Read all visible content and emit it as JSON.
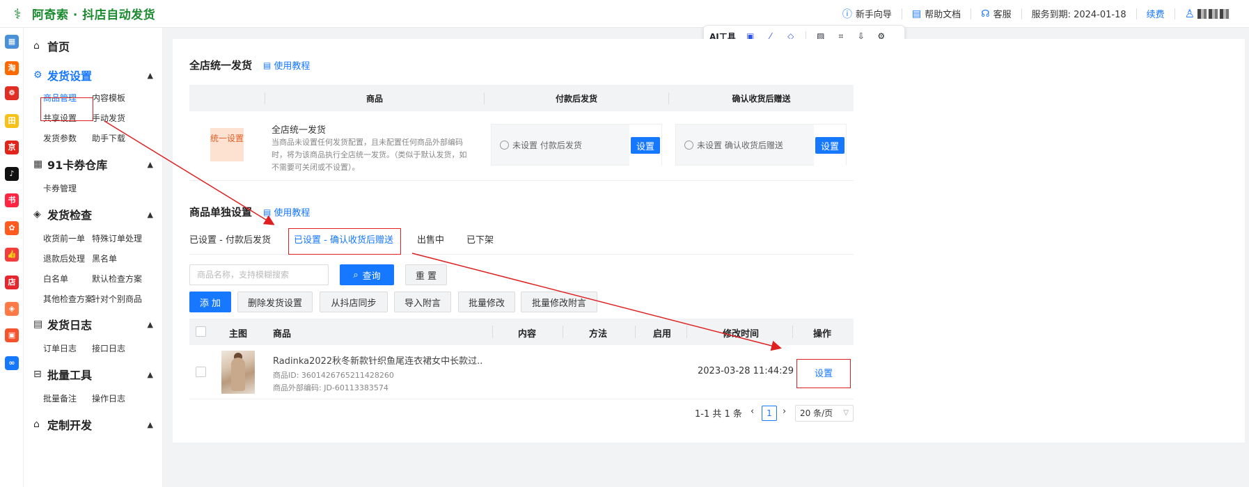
{
  "header": {
    "logo_mark": "⚕",
    "app_title": "阿奇索 · 抖店自动发货",
    "guide": "新手向导",
    "help": "帮助文档",
    "service": "客服",
    "expire_label": "服务到期: 2024-01-18",
    "renew": "续费"
  },
  "float_toolbar": {
    "ai_label": "AI工具"
  },
  "rail": [
    {
      "name": "qr-icon",
      "glyph": "▦",
      "color": "#4a90d9"
    },
    {
      "name": "taobao-icon",
      "glyph": "淘",
      "color": "#ff6a00"
    },
    {
      "name": "pinduoduo-icon",
      "glyph": "❁",
      "color": "#e02e24"
    },
    {
      "name": "store-yellow-icon",
      "glyph": "田",
      "color": "#f6c21a"
    },
    {
      "name": "jd-icon",
      "glyph": "京",
      "color": "#e1251b"
    },
    {
      "name": "douyin-icon",
      "glyph": "♪",
      "color": "#111111"
    },
    {
      "name": "xiaohongshu-icon",
      "glyph": "书",
      "color": "#ff2442"
    },
    {
      "name": "grid-orange-icon",
      "glyph": "✿",
      "color": "#ff5a1f"
    },
    {
      "name": "thumb-icon",
      "glyph": "👍",
      "color": "#f23d3d"
    },
    {
      "name": "shop-icon",
      "glyph": "店",
      "color": "#e6262e"
    },
    {
      "name": "bag-orange-icon",
      "glyph": "◈",
      "color": "#ff7a45"
    },
    {
      "name": "bag-red-icon",
      "glyph": "▣",
      "color": "#f5532d"
    },
    {
      "name": "link-icon",
      "glyph": "∞",
      "color": "#1677ff"
    }
  ],
  "sidebar": {
    "home": "首页",
    "groups": [
      {
        "label": "发货设置",
        "items": [
          "商品管理",
          "内容模板",
          "共享设置",
          "手动发货",
          "发货参数",
          "助手下载"
        ]
      },
      {
        "label": "91卡券仓库",
        "items": [
          "卡券管理"
        ]
      },
      {
        "label": "发货检查",
        "items": [
          "收货前一单",
          "特殊订单处理",
          "退款后处理",
          "黑名单",
          "白名单",
          "默认检查方案",
          "其他检查方案",
          "针对个别商品"
        ]
      },
      {
        "label": "发货日志",
        "items": [
          "订单日志",
          "接口日志"
        ]
      },
      {
        "label": "批量工具",
        "items": [
          "批量备注",
          "操作日志"
        ]
      },
      {
        "label": "定制开发",
        "items": []
      }
    ]
  },
  "store_section": {
    "title": "全店统一发货",
    "tutorial": "使用教程",
    "columns": [
      "商品",
      "付款后发货",
      "确认收货后赠送"
    ],
    "badge": "统一设置",
    "row_title": "全店统一发货",
    "row_desc": "当商品未设置任何发货配置，且未配置任何商品外部编码时，将为该商品执行全店统一发货。（类似于默认发货，如不需要可关闭或不设置）。",
    "pay_option": "未设置 付款后发货",
    "confirm_option": "未设置 确认收货后赠送",
    "set_button": "设置"
  },
  "product_section": {
    "title": "商品单独设置",
    "tutorial": "使用教程",
    "tabs": [
      "已设置 - 付款后发货",
      "已设置 - 确认收货后赠送",
      "出售中",
      "已下架"
    ],
    "search_placeholder": "商品名称，支持模糊搜索",
    "query": "查询",
    "reset": "重 置",
    "actions": [
      "添 加",
      "删除发货设置",
      "从抖店同步",
      "导入附言",
      "批量修改",
      "批量修改附言"
    ],
    "columns": [
      "主图",
      "商品",
      "内容",
      "方法",
      "启用",
      "修改时间",
      "操作"
    ],
    "rows": [
      {
        "title": "Radinka2022秋冬新款针织鱼尾连衣裙女中长款过...",
        "id_label": "商品ID: 3601426765211428260",
        "code_label": "商品外部编码: JD-60113383574",
        "time": "2023-03-28 11:44:29",
        "action": "设置"
      }
    ],
    "pagination": {
      "summary": "1-1 共 1 条",
      "current": "1",
      "page_size": "20 条/页"
    }
  }
}
